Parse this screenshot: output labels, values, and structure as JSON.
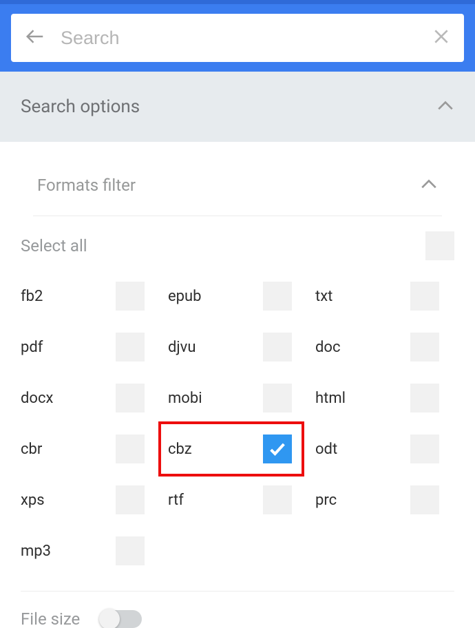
{
  "search": {
    "placeholder": "Search",
    "value": ""
  },
  "sections": {
    "options_label": "Search options",
    "formats_label": "Formats filter"
  },
  "formats": {
    "select_all_label": "Select all",
    "select_all_checked": false,
    "items": [
      {
        "label": "fb2",
        "checked": false,
        "highlight": false
      },
      {
        "label": "epub",
        "checked": false,
        "highlight": false
      },
      {
        "label": "txt",
        "checked": false,
        "highlight": false
      },
      {
        "label": "pdf",
        "checked": false,
        "highlight": false
      },
      {
        "label": "djvu",
        "checked": false,
        "highlight": false
      },
      {
        "label": "doc",
        "checked": false,
        "highlight": false
      },
      {
        "label": "docx",
        "checked": false,
        "highlight": false
      },
      {
        "label": "mobi",
        "checked": false,
        "highlight": false
      },
      {
        "label": "html",
        "checked": false,
        "highlight": false
      },
      {
        "label": "cbr",
        "checked": false,
        "highlight": false
      },
      {
        "label": "cbz",
        "checked": true,
        "highlight": true
      },
      {
        "label": "odt",
        "checked": false,
        "highlight": false
      },
      {
        "label": "xps",
        "checked": false,
        "highlight": false
      },
      {
        "label": "rtf",
        "checked": false,
        "highlight": false
      },
      {
        "label": "prc",
        "checked": false,
        "highlight": false
      },
      {
        "label": "mp3",
        "checked": false,
        "highlight": false
      }
    ]
  },
  "filesize": {
    "label": "File size",
    "enabled": false
  }
}
